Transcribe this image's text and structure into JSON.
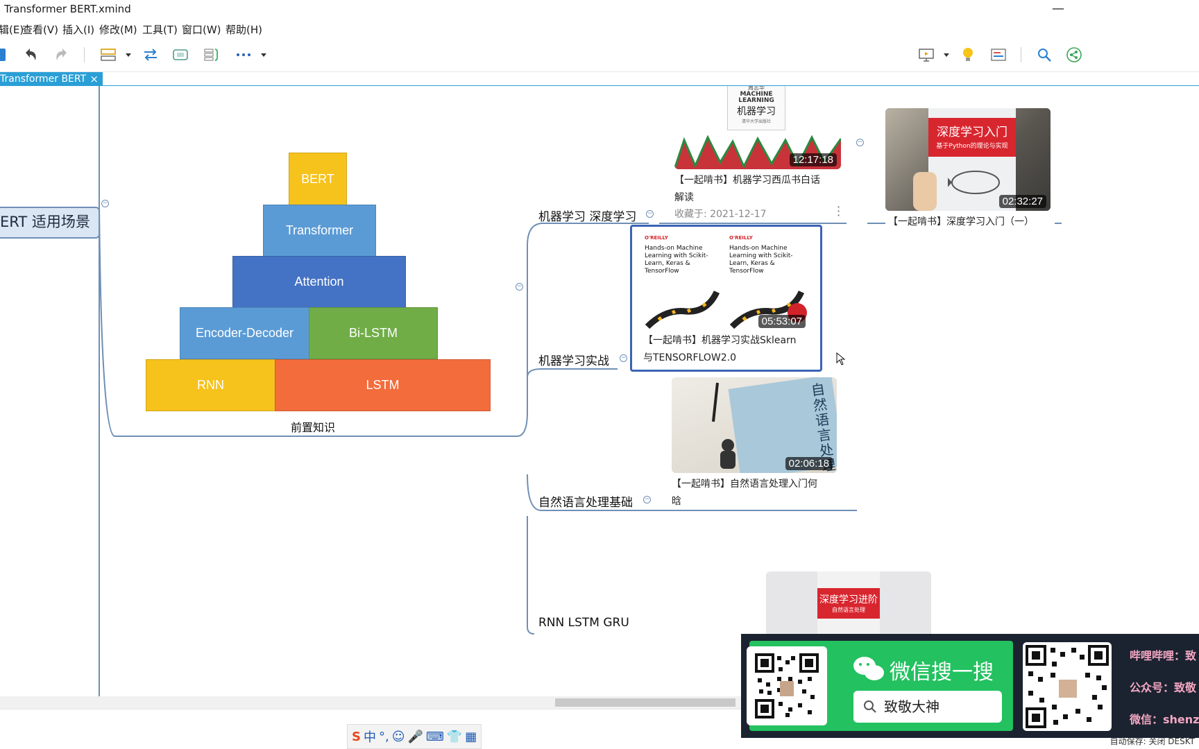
{
  "window": {
    "title": "Transformer BERT.xmind"
  },
  "menu": [
    "编辑(E)",
    "查看(V)",
    "插入(I)",
    "修改(M)",
    "工具(T)",
    "窗口(W)",
    "帮助(H)"
  ],
  "menu_visible": [
    "辑(E)",
    "查看(V)",
    "插入(I)",
    "修改(M)",
    "工具(T)",
    "窗口(W)",
    "帮助(H)"
  ],
  "tab": {
    "label": "Transformer BERT",
    "close": "×"
  },
  "root": {
    "label": "ERT 适用场景"
  },
  "pyramid": {
    "bert": "BERT",
    "transformer": "Transformer",
    "attention": "Attention",
    "encoder_decoder": "Encoder-Decoder",
    "bilstm": "Bi-LSTM",
    "rnn": "RNN",
    "lstm": "LSTM",
    "caption": "前置知识",
    "colors": {
      "yellow": "#f6c21c",
      "lightblue": "#5b9bd5",
      "blue": "#4472c4",
      "green": "#70ad47",
      "orange": "#f36c3c"
    }
  },
  "branches": [
    {
      "label": "机器学习 深度学习"
    },
    {
      "label": "机器学习实战"
    },
    {
      "label": "自然语言处理基础"
    },
    {
      "label": "RNN LSTM GRU"
    }
  ],
  "cards": {
    "xigua": {
      "duration": "12:17:18",
      "title_line1": "【一起啃书】机器学习西瓜书白话",
      "title_line2": "解读",
      "meta": "收藏于:  2021-12-17",
      "book_author": "周志华",
      "book_title_en": "MACHINE LEARNING",
      "book_title_cn": "机器学习",
      "publisher": "清华大学出版社"
    },
    "dl_intro": {
      "duration": "02:32:27",
      "title": "【一起啃书】深度学习入门（一）",
      "book_cn": "深度学习入门",
      "book_sub": "基于Python的理论与实现"
    },
    "handson": {
      "duration": "05:53:07",
      "title_line1": "【一起啃书】机器学习实战Sklearn",
      "title_line2": "与TENSORFLOW2.0",
      "book_text": "Hands-on Machine Learning with Scikit-Learn, Keras & TensorFlow",
      "publisher": "O'REILLY"
    },
    "nlp_intro": {
      "duration": "02:06:18",
      "title_line1": "【一起啃书】自然语言处理入门何",
      "title_line2": "晗",
      "book_cn": "自然语言处理入门"
    },
    "dl_adv": {
      "book_cn": "深度学习进阶",
      "book_sub": "自然语言处理"
    }
  },
  "banner": {
    "wechat_title": "微信搜一搜",
    "search_text": "致敬大神",
    "bilibili": "哔哩哔哩：致",
    "gzh": "公众号：致敬",
    "weixin": "微信：shenz"
  },
  "status": {
    "autosave": "自动保存: 关闭   DESKT"
  },
  "ime": [
    "中",
    "°,",
    "☺",
    "🎤",
    "⌨",
    "👕",
    "▦"
  ]
}
